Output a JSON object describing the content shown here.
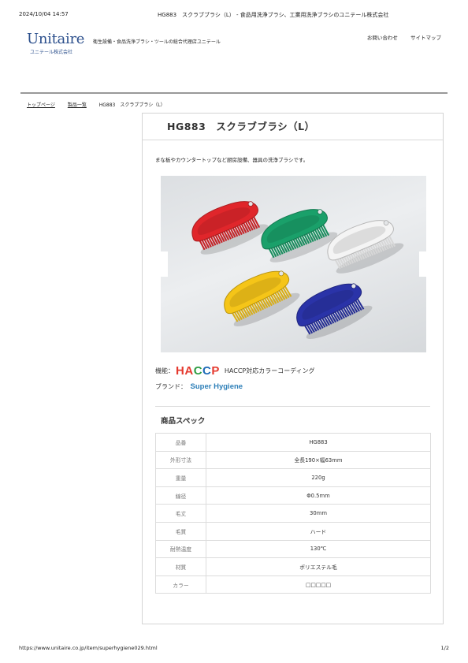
{
  "print_header": {
    "date": "2024/10/04 14:57",
    "title": "HG883　スクラブブラシ（L） - 食品用洗浄ブラシ、工業用洗浄ブラシのユニテール株式会社"
  },
  "site": {
    "logo_main": "Unitaire",
    "logo_sub": "ユニテール株式会社",
    "tagline": "衛生設備・食品洗浄ブラシ・ツールの総合代理店ユニテール",
    "links": [
      "お問い合わせ",
      "サイトマップ"
    ]
  },
  "breadcrumb": [
    "トップページ",
    "製品一覧",
    "HG883　スクラブブラシ（L）"
  ],
  "product": {
    "title": "HG883　スクラブブラシ（L）",
    "description": "まな板やカウンタートップなど厨房設備、器具の洗浄ブラシです。",
    "brush_colors": [
      "#e0262b",
      "#1aa06a",
      "#f4f4f4",
      "#f5c518",
      "#2a33a8"
    ],
    "feature_label": "機能：",
    "haccp_letters": [
      "H",
      "A",
      "C",
      "C",
      "P"
    ],
    "haccp_colors": [
      "#e53a2f",
      "#e53a2f",
      "#2e9d43",
      "#1e6bb8",
      "#e53a2f"
    ],
    "feature_text": "HACCP対応カラーコーディング",
    "brand_label": "ブランド：",
    "brand_name": "Super Hygiene"
  },
  "spec": {
    "heading": "商品スペック",
    "rows": [
      {
        "label": "品番",
        "value": "HG883"
      },
      {
        "label": "外形寸法",
        "value": "全長190×幅63mm"
      },
      {
        "label": "重量",
        "value": "220g"
      },
      {
        "label": "線径",
        "value": "Φ0.5mm"
      },
      {
        "label": "毛丈",
        "value": "30mm"
      },
      {
        "label": "毛質",
        "value": "ハード"
      },
      {
        "label": "耐熱温度",
        "value": "130℃"
      },
      {
        "label": "材質",
        "value": "ポリエステル毛"
      },
      {
        "label": "カラー",
        "value": "□□□□□"
      }
    ]
  },
  "print_footer": {
    "url": "https://www.unitaire.co.jp/item/superhygiene029.html",
    "page": "1/2"
  }
}
